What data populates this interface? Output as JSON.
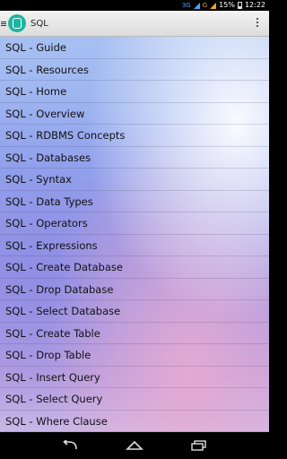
{
  "status_bar": {
    "network_label": "3G",
    "second_network_label": "G",
    "battery_percent": "15%",
    "time": "12:22"
  },
  "app_bar": {
    "title": "SQL",
    "icons": [
      "menu-icon",
      "database-logo-icon",
      "overflow-menu-icon"
    ]
  },
  "menu": {
    "items": [
      {
        "label": "SQL - Guide"
      },
      {
        "label": "SQL - Resources"
      },
      {
        "label": "SQL - Home"
      },
      {
        "label": "SQL - Overview"
      },
      {
        "label": "SQL - RDBMS Concepts"
      },
      {
        "label": "SQL - Databases"
      },
      {
        "label": "SQL - Syntax"
      },
      {
        "label": "SQL - Data Types"
      },
      {
        "label": "SQL - Operators"
      },
      {
        "label": "SQL - Expressions"
      },
      {
        "label": "SQL - Create Database"
      },
      {
        "label": "SQL - Drop Database"
      },
      {
        "label": "SQL - Select Database"
      },
      {
        "label": "SQL - Create Table"
      },
      {
        "label": "SQL - Drop Table"
      },
      {
        "label": "SQL - Insert Query"
      },
      {
        "label": "SQL - Select Query"
      },
      {
        "label": "SQL - Where Clause"
      }
    ]
  },
  "nav_bar": {
    "icons": [
      "back-icon",
      "home-icon",
      "recent-apps-icon"
    ]
  },
  "colors": {
    "status_accent": "#4aa3ff",
    "status_warning": "#f0a030",
    "logo": "#1fb5a0"
  }
}
